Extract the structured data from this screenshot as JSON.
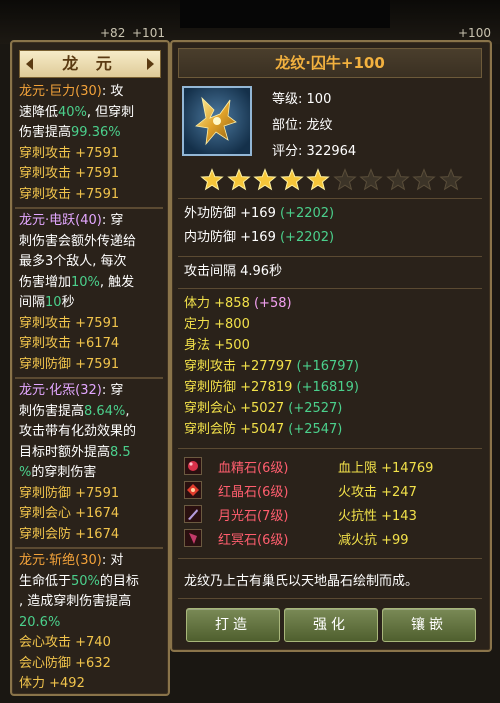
{
  "topbar": {
    "num_left": "+82",
    "num_mid": "+101",
    "num_right": "+100"
  },
  "left": {
    "title": "龙 元",
    "sections": [
      {
        "head_name": "龙元·巨力(30)",
        "head_tail": ": 攻",
        "lines": [
          [
            "速降低",
            "40%",
            ", 但穿刺"
          ],
          [
            "伤害提高",
            "99.36%",
            ""
          ]
        ],
        "stats": [
          "穿刺攻击 +7591",
          "穿刺攻击 +7591",
          "穿刺攻击 +7591"
        ]
      },
      {
        "head_name": "龙元·电跃(40)",
        "head_tail": ": 穿",
        "text_lines": [
          "刺伤害会额外传递给",
          "最多3个敌人, 每次"
        ],
        "line_pct": [
          "伤害增加",
          "10%",
          ", 触发"
        ],
        "line_sec": [
          "间隔",
          "10",
          "秒"
        ],
        "stats": [
          "穿刺攻击 +7591",
          "穿刺攻击 +6174",
          "穿刺防御 +7591"
        ]
      },
      {
        "head_name": "龙元·化炁(32)",
        "head_tail": ": 穿",
        "line1": [
          "刺伤害提高",
          "8.64%",
          ","
        ],
        "line2": "攻击带有化劲效果的",
        "line3": [
          "目标时额外提高",
          "8.5"
        ],
        "line4": [
          "%",
          "的穿刺伤害"
        ],
        "stats": [
          "穿刺防御 +7591",
          "穿刺会心 +1674",
          "穿刺会防 +1674"
        ]
      },
      {
        "head_name": "龙元·斩绝(30)",
        "head_tail": ": 对",
        "line1": [
          "生命低于",
          "50%",
          "的目标"
        ],
        "line2": ", 造成穿刺伤害提高",
        "line3": "20.6%",
        "stats": [
          "会心攻击 +740",
          "会心防御 +632",
          "体力 +492"
        ]
      }
    ]
  },
  "item": {
    "title_name": "龙纹·囚牛",
    "title_plus": "+100",
    "level_label": "等级:",
    "level_value": "100",
    "slot_label": "部位:",
    "slot_value": "龙纹",
    "score_label": "评分:",
    "score_value": "322964",
    "stars_filled": 5,
    "stars_total": 10
  },
  "defense": [
    {
      "text": "外功防御 +169",
      "bonus": "(+2202)"
    },
    {
      "text": "内功防御 +169",
      "bonus": "(+2202)"
    }
  ],
  "attack_interval": "攻击间隔 4.96秒",
  "base_attrs": [
    {
      "text": "体力 +858",
      "bonus": "(+58)"
    },
    {
      "text": "定力 +800",
      "bonus": ""
    },
    {
      "text": "身法 +500",
      "bonus": ""
    }
  ],
  "pierce_attrs": [
    {
      "text": "穿刺攻击 +27797",
      "bonus": "(+16797)"
    },
    {
      "text": "穿刺防御 +27819",
      "bonus": "(+16819)"
    },
    {
      "text": "穿刺会心 +5027",
      "bonus": "(+2527)"
    },
    {
      "text": "穿刺会防 +5047",
      "bonus": "(+2547)"
    }
  ],
  "gems": [
    {
      "icon": "blood-essence-gem-icon",
      "name": "血精石(6级)",
      "attr": "血上限 +14769",
      "color": "#d9314a"
    },
    {
      "icon": "red-crystal-gem-icon",
      "name": "红晶石(6级)",
      "attr": "火攻击 +247",
      "color": "#e23c2c"
    },
    {
      "icon": "moonlight-gem-icon",
      "name": "月光石(7级)",
      "attr": "火抗性 +143",
      "color": "#b49cdc"
    },
    {
      "icon": "red-dark-gem-icon",
      "name": "红冥石(6级)",
      "attr": "减火抗 +99",
      "color": "#c23a6a"
    }
  ],
  "description": "龙纹乃上古有巢氏以天地晶石绘制而成。",
  "buttons": {
    "forge": "打造",
    "enhance": "强化",
    "inlay": "镶嵌"
  }
}
